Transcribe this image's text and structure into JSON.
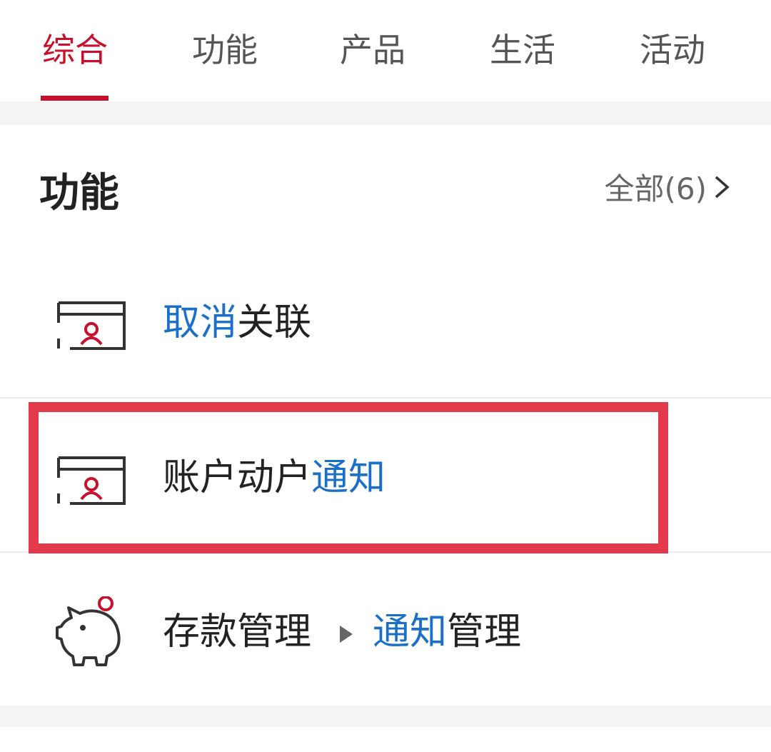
{
  "tabs": [
    {
      "label": "综合",
      "active": true
    },
    {
      "label": "功能",
      "active": false
    },
    {
      "label": "产品",
      "active": false
    },
    {
      "label": "生活",
      "active": false
    },
    {
      "label": "活动",
      "active": false
    }
  ],
  "section": {
    "title": "功能",
    "view_all": "全部(6)"
  },
  "items": [
    {
      "prefix": "",
      "highlight": "取消",
      "suffix": "关联",
      "icon": "card-user-icon"
    },
    {
      "prefix": "账户动户",
      "highlight": "通知",
      "suffix": "",
      "icon": "card-user-icon"
    },
    {
      "prefix": "存款管理",
      "sep": "▸",
      "highlight": "通知",
      "suffix": "管理",
      "icon": "piggy-bank-icon"
    }
  ],
  "colors": {
    "accent": "#c8102e",
    "link": "#1a6fc9",
    "highlight_box": "#e23a4a"
  }
}
